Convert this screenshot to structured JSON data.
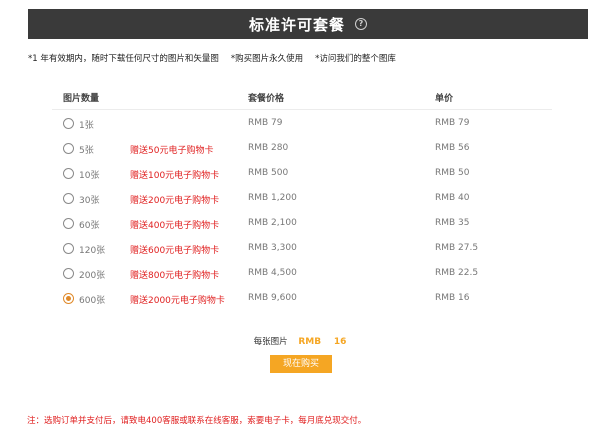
{
  "header": {
    "title": "标准许可套餐",
    "help_icon": "?"
  },
  "features": [
    "*1 年有效期内，随时下载任何尺寸的图片和矢量图",
    "*购买图片永久使用",
    "*访问我们的整个图库"
  ],
  "table": {
    "headers": {
      "quantity": "图片数量",
      "package_price": "套餐价格",
      "unit_price": "单价"
    },
    "rows": [
      {
        "qty": "1张",
        "gift": "",
        "price": "RMB 79",
        "unit": "RMB 79",
        "selected": false
      },
      {
        "qty": "5张",
        "gift": "赠送50元电子购物卡",
        "price": "RMB 280",
        "unit": "RMB 56",
        "selected": false
      },
      {
        "qty": "10张",
        "gift": "赠送100元电子购物卡",
        "price": "RMB 500",
        "unit": "RMB 50",
        "selected": false
      },
      {
        "qty": "30张",
        "gift": "赠送200元电子购物卡",
        "price": "RMB 1,200",
        "unit": "RMB 40",
        "selected": false
      },
      {
        "qty": "60张",
        "gift": "赠送400元电子购物卡",
        "price": "RMB 2,100",
        "unit": "RMB 35",
        "selected": false
      },
      {
        "qty": "120张",
        "gift": "赠送600元电子购物卡",
        "price": "RMB 3,300",
        "unit": "RMB 27.5",
        "selected": false
      },
      {
        "qty": "200张",
        "gift": "赠送800元电子购物卡",
        "price": "RMB 4,500",
        "unit": "RMB 22.5",
        "selected": false
      },
      {
        "qty": "600张",
        "gift": "赠送2000元电子购物卡",
        "price": "RMB 9,600",
        "unit": "RMB 16",
        "selected": true
      }
    ]
  },
  "summary": {
    "label": "每张图片",
    "currency": "RMB",
    "value": "16"
  },
  "buy_button": {
    "label": "现在购买"
  },
  "note": "注：选购订单并支付后，请致电400客服或联系在线客服，索要电子卡，每月底兑现交付。",
  "colors": {
    "header_bg": "#3a3a3a",
    "accent": "#f5a623",
    "gift_red": "#e02020"
  }
}
